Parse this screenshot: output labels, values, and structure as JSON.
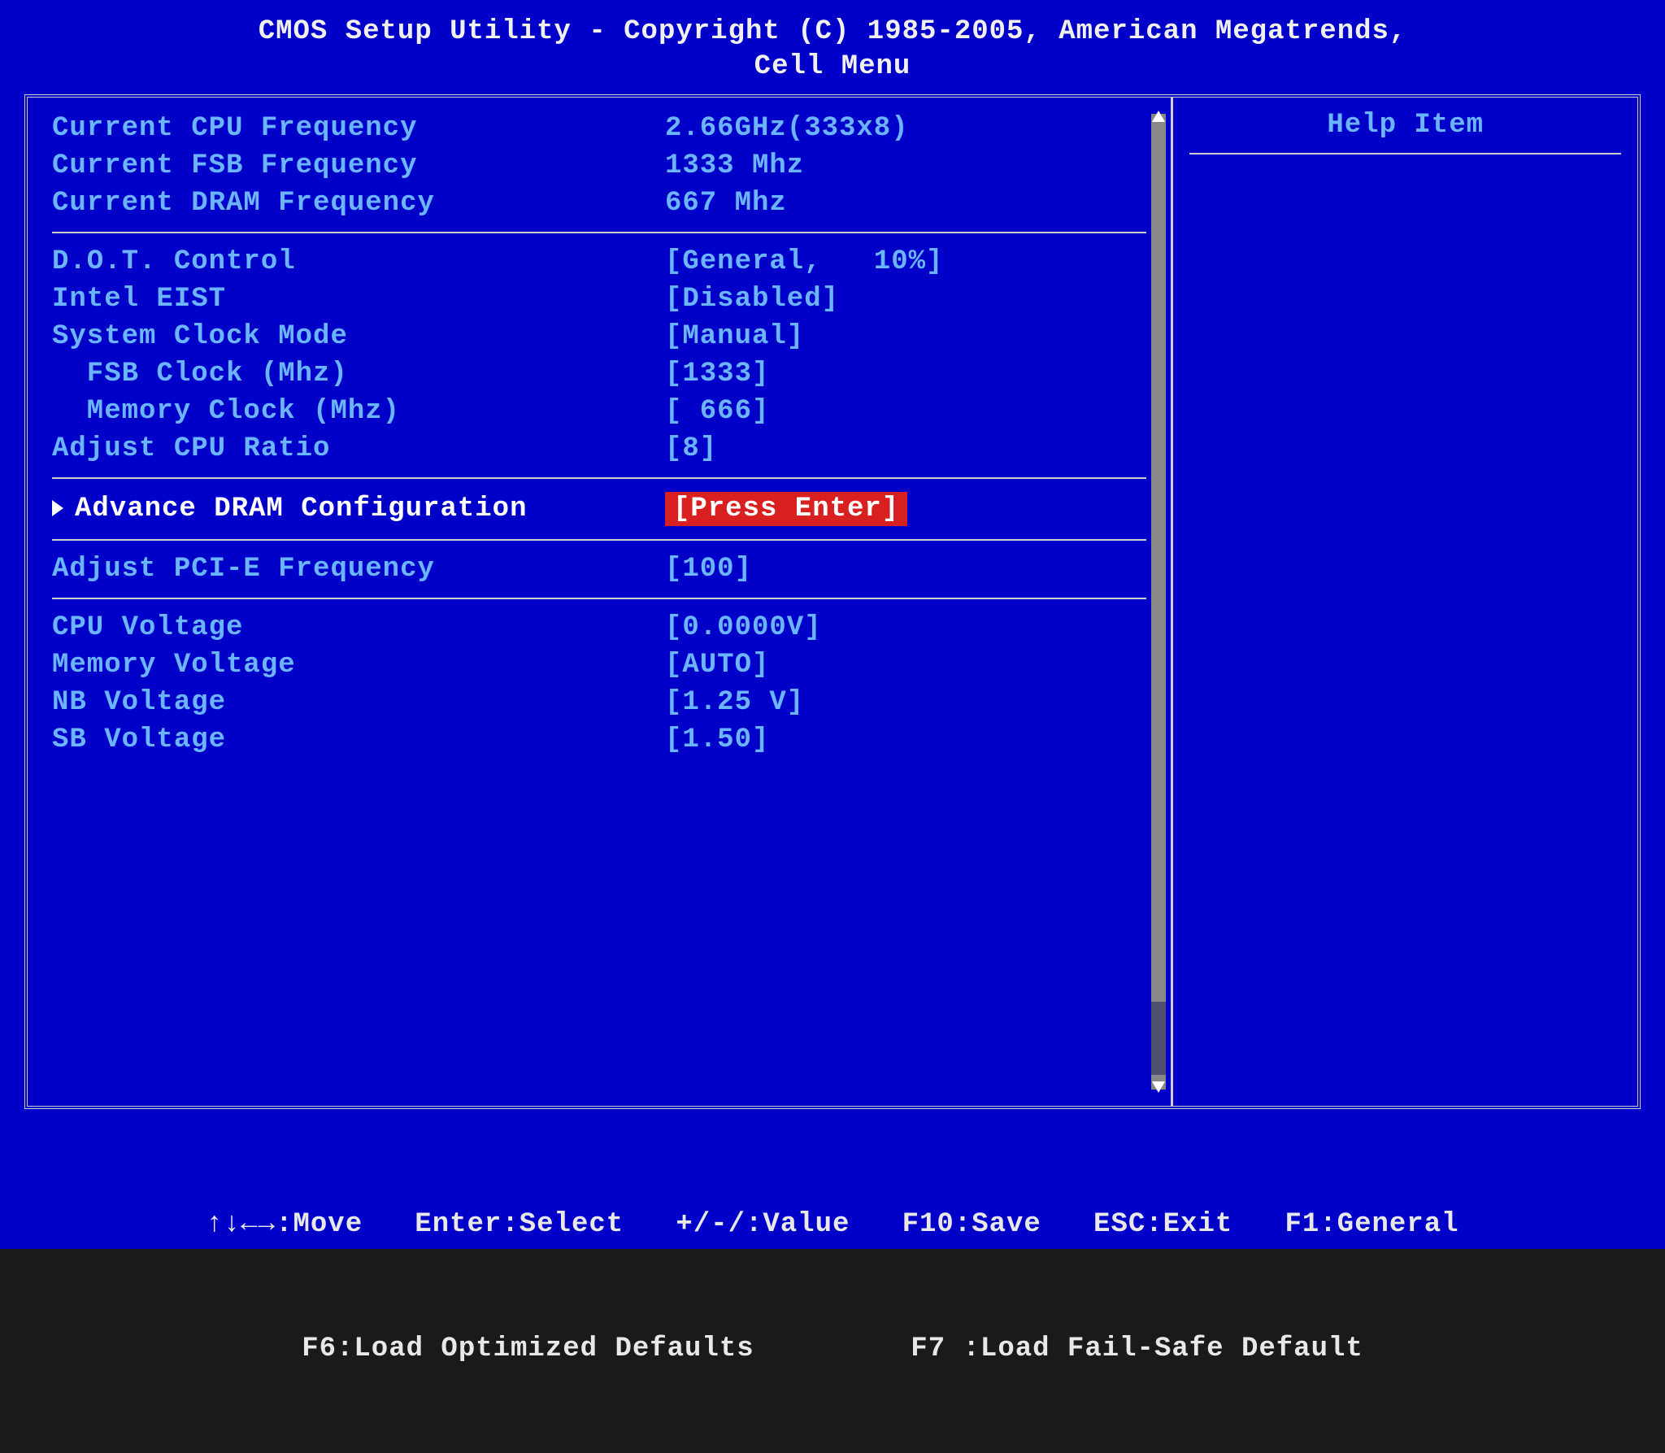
{
  "header": {
    "title": "CMOS Setup Utility - Copyright (C) 1985-2005, American Megatrends,",
    "subtitle": "Cell Menu"
  },
  "help_panel": {
    "title": "Help Item"
  },
  "sections": {
    "info": [
      {
        "label": "Current CPU Frequency",
        "value": "2.66GHz(333x8)"
      },
      {
        "label": "Current FSB Frequency",
        "value": "1333 Mhz"
      },
      {
        "label": "Current DRAM Frequency",
        "value": "667 Mhz"
      }
    ],
    "clock": [
      {
        "label": "D.O.T. Control",
        "value": "[General,   10%]"
      },
      {
        "label": "Intel EIST",
        "value": "[Disabled]"
      },
      {
        "label": "System Clock Mode",
        "value": "[Manual]"
      },
      {
        "label": "  FSB Clock (Mhz)",
        "value": "[1333]"
      },
      {
        "label": "  Memory Clock (Mhz)",
        "value": "[ 666]"
      },
      {
        "label": "Adjust CPU Ratio",
        "value": "[8]"
      }
    ],
    "dram": {
      "label": "Advance DRAM Configuration",
      "value": "[Press Enter]"
    },
    "pcie": [
      {
        "label": "Adjust PCI-E Frequency",
        "value": "[100]"
      }
    ],
    "voltage": [
      {
        "label": "CPU Voltage",
        "value": "[0.0000V]"
      },
      {
        "label": "Memory Voltage",
        "value": "[AUTO]"
      },
      {
        "label": "NB Voltage",
        "value": "[1.25 V]"
      },
      {
        "label": "SB Voltage",
        "value": "[1.50]"
      }
    ]
  },
  "footer": {
    "line1": "↑↓←→:Move   Enter:Select   +/-/:Value   F10:Save   ESC:Exit   F1:General",
    "line2": "F6:Load Optimized Defaults         F7 :Load Fail-Safe Default"
  }
}
